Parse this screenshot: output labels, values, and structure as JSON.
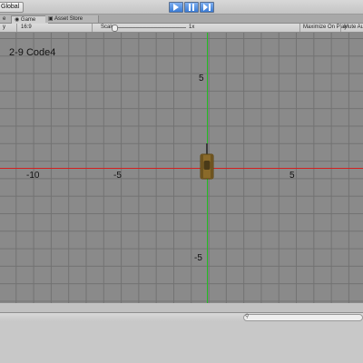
{
  "toolbar": {
    "global_label": "Global",
    "play_icon": "play-icon",
    "pause_icon": "pause-icon",
    "step_icon": "step-icon",
    "accent": "#3a7bd5"
  },
  "tabs": [
    {
      "label": "e"
    },
    {
      "label": "Game",
      "icon": "game-icon",
      "active": true
    },
    {
      "label": "Asset Store",
      "icon": "asset-store-icon"
    }
  ],
  "game_bar": {
    "display": "y",
    "aspect": "16:9",
    "scale_label": "Scale",
    "scale_value": "1x",
    "maximize_label": "Maximize On Play",
    "mute_label": "Mute Au"
  },
  "viewport": {
    "code_label": "2-9  Code4",
    "axis_labels": {
      "x_neg10": "-10",
      "x_neg5": "-5",
      "x_5": "5",
      "y_5": "5",
      "y_neg5": "-5"
    },
    "colors": {
      "x_axis": "#d22020",
      "y_axis": "#22c022",
      "grid": "#727272",
      "background": "#8a8a8a",
      "tank": "#8a6a2a"
    }
  }
}
